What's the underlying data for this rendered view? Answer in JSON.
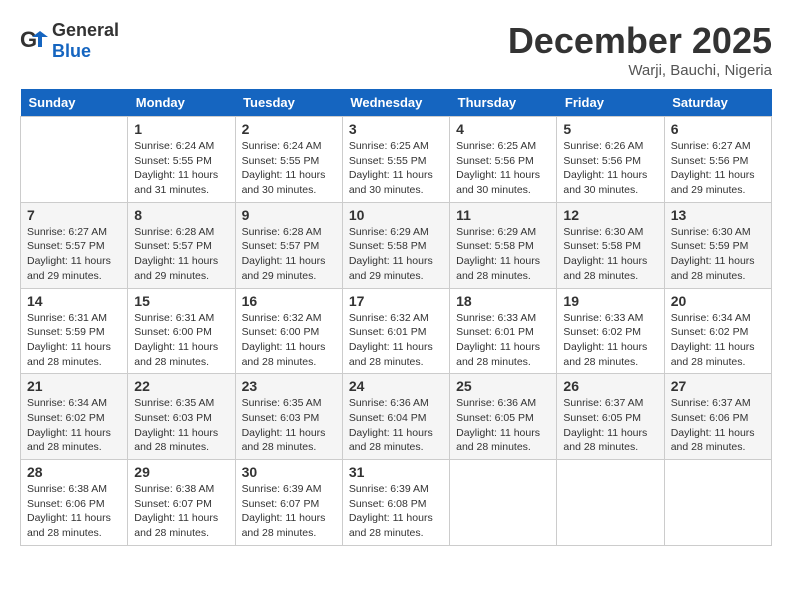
{
  "logo": {
    "general": "General",
    "blue": "Blue"
  },
  "title": "December 2025",
  "subtitle": "Warji, Bauchi, Nigeria",
  "headers": [
    "Sunday",
    "Monday",
    "Tuesday",
    "Wednesday",
    "Thursday",
    "Friday",
    "Saturday"
  ],
  "weeks": [
    [
      {
        "date": "",
        "text": ""
      },
      {
        "date": "1",
        "text": "Sunrise: 6:24 AM\nSunset: 5:55 PM\nDaylight: 11 hours and 31 minutes."
      },
      {
        "date": "2",
        "text": "Sunrise: 6:24 AM\nSunset: 5:55 PM\nDaylight: 11 hours and 30 minutes."
      },
      {
        "date": "3",
        "text": "Sunrise: 6:25 AM\nSunset: 5:55 PM\nDaylight: 11 hours and 30 minutes."
      },
      {
        "date": "4",
        "text": "Sunrise: 6:25 AM\nSunset: 5:56 PM\nDaylight: 11 hours and 30 minutes."
      },
      {
        "date": "5",
        "text": "Sunrise: 6:26 AM\nSunset: 5:56 PM\nDaylight: 11 hours and 30 minutes."
      },
      {
        "date": "6",
        "text": "Sunrise: 6:27 AM\nSunset: 5:56 PM\nDaylight: 11 hours and 29 minutes."
      }
    ],
    [
      {
        "date": "7",
        "text": "Sunrise: 6:27 AM\nSunset: 5:57 PM\nDaylight: 11 hours and 29 minutes."
      },
      {
        "date": "8",
        "text": "Sunrise: 6:28 AM\nSunset: 5:57 PM\nDaylight: 11 hours and 29 minutes."
      },
      {
        "date": "9",
        "text": "Sunrise: 6:28 AM\nSunset: 5:57 PM\nDaylight: 11 hours and 29 minutes."
      },
      {
        "date": "10",
        "text": "Sunrise: 6:29 AM\nSunset: 5:58 PM\nDaylight: 11 hours and 29 minutes."
      },
      {
        "date": "11",
        "text": "Sunrise: 6:29 AM\nSunset: 5:58 PM\nDaylight: 11 hours and 28 minutes."
      },
      {
        "date": "12",
        "text": "Sunrise: 6:30 AM\nSunset: 5:58 PM\nDaylight: 11 hours and 28 minutes."
      },
      {
        "date": "13",
        "text": "Sunrise: 6:30 AM\nSunset: 5:59 PM\nDaylight: 11 hours and 28 minutes."
      }
    ],
    [
      {
        "date": "14",
        "text": "Sunrise: 6:31 AM\nSunset: 5:59 PM\nDaylight: 11 hours and 28 minutes."
      },
      {
        "date": "15",
        "text": "Sunrise: 6:31 AM\nSunset: 6:00 PM\nDaylight: 11 hours and 28 minutes."
      },
      {
        "date": "16",
        "text": "Sunrise: 6:32 AM\nSunset: 6:00 PM\nDaylight: 11 hours and 28 minutes."
      },
      {
        "date": "17",
        "text": "Sunrise: 6:32 AM\nSunset: 6:01 PM\nDaylight: 11 hours and 28 minutes."
      },
      {
        "date": "18",
        "text": "Sunrise: 6:33 AM\nSunset: 6:01 PM\nDaylight: 11 hours and 28 minutes."
      },
      {
        "date": "19",
        "text": "Sunrise: 6:33 AM\nSunset: 6:02 PM\nDaylight: 11 hours and 28 minutes."
      },
      {
        "date": "20",
        "text": "Sunrise: 6:34 AM\nSunset: 6:02 PM\nDaylight: 11 hours and 28 minutes."
      }
    ],
    [
      {
        "date": "21",
        "text": "Sunrise: 6:34 AM\nSunset: 6:02 PM\nDaylight: 11 hours and 28 minutes."
      },
      {
        "date": "22",
        "text": "Sunrise: 6:35 AM\nSunset: 6:03 PM\nDaylight: 11 hours and 28 minutes."
      },
      {
        "date": "23",
        "text": "Sunrise: 6:35 AM\nSunset: 6:03 PM\nDaylight: 11 hours and 28 minutes."
      },
      {
        "date": "24",
        "text": "Sunrise: 6:36 AM\nSunset: 6:04 PM\nDaylight: 11 hours and 28 minutes."
      },
      {
        "date": "25",
        "text": "Sunrise: 6:36 AM\nSunset: 6:05 PM\nDaylight: 11 hours and 28 minutes."
      },
      {
        "date": "26",
        "text": "Sunrise: 6:37 AM\nSunset: 6:05 PM\nDaylight: 11 hours and 28 minutes."
      },
      {
        "date": "27",
        "text": "Sunrise: 6:37 AM\nSunset: 6:06 PM\nDaylight: 11 hours and 28 minutes."
      }
    ],
    [
      {
        "date": "28",
        "text": "Sunrise: 6:38 AM\nSunset: 6:06 PM\nDaylight: 11 hours and 28 minutes."
      },
      {
        "date": "29",
        "text": "Sunrise: 6:38 AM\nSunset: 6:07 PM\nDaylight: 11 hours and 28 minutes."
      },
      {
        "date": "30",
        "text": "Sunrise: 6:39 AM\nSunset: 6:07 PM\nDaylight: 11 hours and 28 minutes."
      },
      {
        "date": "31",
        "text": "Sunrise: 6:39 AM\nSunset: 6:08 PM\nDaylight: 11 hours and 28 minutes."
      },
      {
        "date": "",
        "text": ""
      },
      {
        "date": "",
        "text": ""
      },
      {
        "date": "",
        "text": ""
      }
    ]
  ]
}
